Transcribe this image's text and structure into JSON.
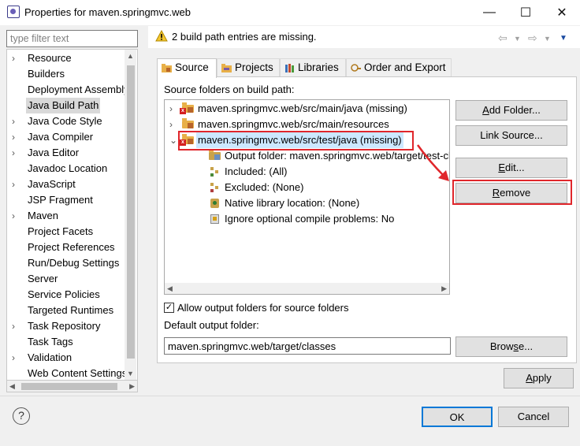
{
  "window": {
    "title": "Properties for maven.springmvc.web",
    "minimize_glyph": "—",
    "maximize_glyph": "☐",
    "close_glyph": "✕"
  },
  "filter": {
    "placeholder": "type filter text"
  },
  "nav": {
    "items": [
      {
        "label": "Resource",
        "expandable": true
      },
      {
        "label": "Builders",
        "expandable": false
      },
      {
        "label": "Deployment Assembly",
        "expandable": false
      },
      {
        "label": "Java Build Path",
        "expandable": false,
        "selected": true
      },
      {
        "label": "Java Code Style",
        "expandable": true
      },
      {
        "label": "Java Compiler",
        "expandable": true
      },
      {
        "label": "Java Editor",
        "expandable": true
      },
      {
        "label": "Javadoc Location",
        "expandable": false
      },
      {
        "label": "JavaScript",
        "expandable": true
      },
      {
        "label": "JSP Fragment",
        "expandable": false
      },
      {
        "label": "Maven",
        "expandable": true
      },
      {
        "label": "Project Facets",
        "expandable": false
      },
      {
        "label": "Project References",
        "expandable": false
      },
      {
        "label": "Run/Debug Settings",
        "expandable": false
      },
      {
        "label": "Server",
        "expandable": false
      },
      {
        "label": "Service Policies",
        "expandable": false
      },
      {
        "label": "Targeted Runtimes",
        "expandable": false
      },
      {
        "label": "Task Repository",
        "expandable": true
      },
      {
        "label": "Task Tags",
        "expandable": false
      },
      {
        "label": "Validation",
        "expandable": true
      },
      {
        "label": "Web Content Settings",
        "expandable": false
      }
    ]
  },
  "message": {
    "text": "2 build path entries are missing."
  },
  "tabs": [
    {
      "label": "Source",
      "icon": "source-folder-icon",
      "active": true
    },
    {
      "label": "Projects",
      "icon": "projects-icon"
    },
    {
      "label": "Libraries",
      "icon": "libraries-icon"
    },
    {
      "label": "Order and Export",
      "icon": "order-export-icon"
    }
  ],
  "source": {
    "label": "Source folders on build path:",
    "rows": [
      {
        "label": "maven.springmvc.web/src/main/java (missing)",
        "level": 0,
        "chevron": "›",
        "icon": "missing-folder-icon"
      },
      {
        "label": "maven.springmvc.web/src/main/resources",
        "level": 0,
        "chevron": "›",
        "icon": "package-folder-icon"
      },
      {
        "label": "maven.springmvc.web/src/test/java (missing)",
        "level": 0,
        "chevron": "⌄",
        "icon": "missing-folder-icon",
        "selected": true
      },
      {
        "label": "Output folder: maven.springmvc.web/target/test-clas",
        "level": 1,
        "icon": "output-folder-icon"
      },
      {
        "label": "Included: (All)",
        "level": 1,
        "icon": "included-icon"
      },
      {
        "label": "Excluded: (None)",
        "level": 1,
        "icon": "excluded-icon"
      },
      {
        "label": "Native library location: (None)",
        "level": 1,
        "icon": "native-library-icon"
      },
      {
        "label": "Ignore optional compile problems: No",
        "level": 1,
        "icon": "ignore-problems-icon"
      }
    ],
    "buttons": {
      "add_folder_pre": "",
      "add_folder_key": "A",
      "add_folder_post": "dd Folder...",
      "link_source": "Link Source...",
      "edit_key": "E",
      "edit_post": "dit...",
      "remove_key": "R",
      "remove_post": "emove"
    },
    "allow_output": {
      "label": "Allow output folders for source folders",
      "checked": true
    },
    "default_output_label": "Default output folder:",
    "default_output_value": "maven.springmvc.web/target/classes",
    "browse_pre": "Brow",
    "browse_key": "s",
    "browse_post": "e..."
  },
  "dialog": {
    "apply_key": "A",
    "apply_post": "pply",
    "ok": "OK",
    "cancel": "Cancel",
    "help_glyph": "?"
  },
  "colors": {
    "annotation_red": "#e0262b",
    "selection_blue": "#cce8ff",
    "primary_button_border": "#0078d7"
  }
}
